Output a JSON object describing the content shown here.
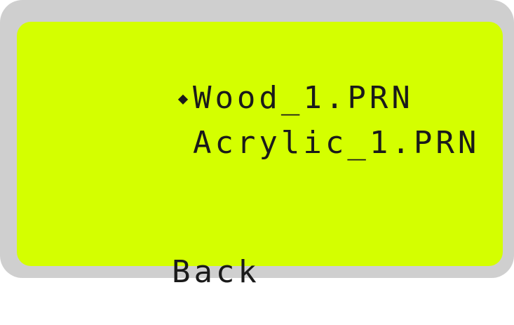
{
  "menu": {
    "selected_marker": "◆",
    "items": [
      {
        "label": "Wood_1.PRN",
        "selected": true
      },
      {
        "label": "Acrylic_1.PRN",
        "selected": false
      }
    ],
    "back_label": "Back"
  },
  "colors": {
    "screen_background": "#d4ff00",
    "bezel": "#cfcfcf",
    "text": "#1a1a1a"
  }
}
